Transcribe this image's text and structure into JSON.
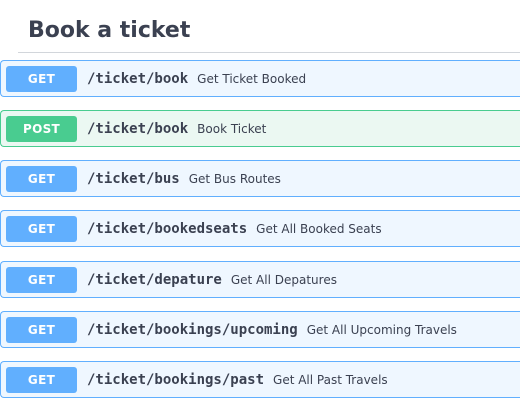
{
  "section": {
    "title": "Book a ticket"
  },
  "operations": [
    {
      "method": "GET",
      "path": "/ticket/book",
      "summary": "Get Ticket Booked"
    },
    {
      "method": "POST",
      "path": "/ticket/book",
      "summary": "Book Ticket"
    },
    {
      "method": "GET",
      "path": "/ticket/bus",
      "summary": "Get Bus Routes"
    },
    {
      "method": "GET",
      "path": "/ticket/bookedseats",
      "summary": "Get All Booked Seats"
    },
    {
      "method": "GET",
      "path": "/ticket/depature",
      "summary": "Get All Depatures"
    },
    {
      "method": "GET",
      "path": "/ticket/bookings/upcoming",
      "summary": "Get All Upcoming Travels"
    },
    {
      "method": "GET",
      "path": "/ticket/bookings/past",
      "summary": "Get All Past Travels"
    }
  ],
  "colors": {
    "get": "#61affe",
    "post": "#49cc90",
    "text": "#3b4151"
  }
}
